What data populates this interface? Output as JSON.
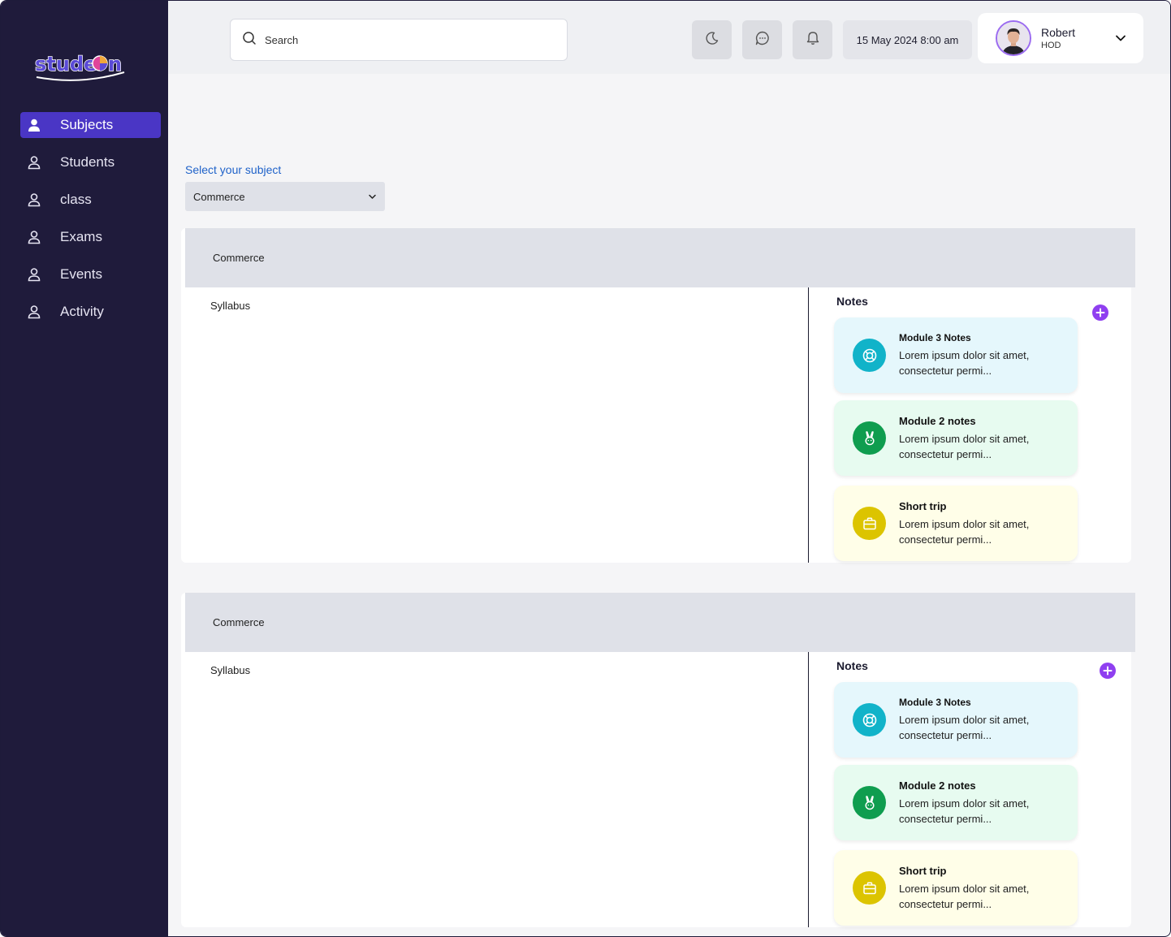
{
  "app": {
    "logo_text": "studeOn"
  },
  "sidebar": {
    "items": [
      {
        "label": "Subjects",
        "active": true
      },
      {
        "label": "Students",
        "active": false
      },
      {
        "label": "class",
        "active": false
      },
      {
        "label": "Exams",
        "active": false
      },
      {
        "label": "Events",
        "active": false
      },
      {
        "label": "Activity",
        "active": false
      }
    ]
  },
  "header": {
    "search_placeholder": "Search",
    "datetime": "15 May 2024 8:00 am",
    "user": {
      "name": "Robert",
      "role": "HOD"
    }
  },
  "main": {
    "select_label": "Select your subject",
    "selected_subject": "Commerce",
    "panels": [
      {
        "title": "Commerce",
        "syllabus_label": "Syllabus",
        "notes_title": "Notes",
        "notes": [
          {
            "title": "Module 3 Notes",
            "desc_line1": "Lorem ipsum dolor sit amet,",
            "desc_line2": "consectetur permi...",
            "icon": "lifebuoy-icon",
            "color": "#11b3c9"
          },
          {
            "title": "Module 2 notes",
            "desc_line1": "Lorem ipsum dolor sit amet,",
            "desc_line2": "consectetur permi...",
            "icon": "rabbit-icon",
            "color": "#0f9d4f"
          },
          {
            "title": "Short trip",
            "desc_line1": "Lorem ipsum dolor sit amet,",
            "desc_line2": "consectetur permi...",
            "icon": "briefcase-icon",
            "color": "#dcc400"
          }
        ]
      },
      {
        "title": "Commerce",
        "syllabus_label": "Syllabus",
        "notes_title": "Notes",
        "notes": [
          {
            "title": "Module 3 Notes",
            "desc_line1": "Lorem ipsum dolor sit amet,",
            "desc_line2": "consectetur permi...",
            "icon": "lifebuoy-icon",
            "color": "#11b3c9"
          },
          {
            "title": "Module 2 notes",
            "desc_line1": "Lorem ipsum dolor sit amet,",
            "desc_line2": "consectetur permi...",
            "icon": "rabbit-icon",
            "color": "#0f9d4f"
          },
          {
            "title": "Short trip",
            "desc_line1": "Lorem ipsum dolor sit amet,",
            "desc_line2": "consectetur permi...",
            "icon": "briefcase-icon",
            "color": "#dcc400"
          }
        ]
      }
    ]
  }
}
